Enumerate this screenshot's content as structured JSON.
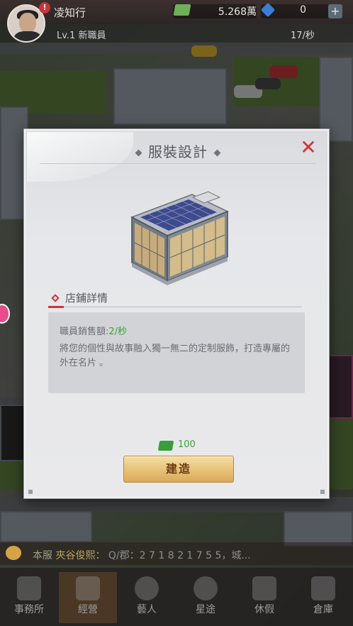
{
  "player": {
    "name": "凌知行",
    "level": "Lv.1 新職員",
    "money": "5.268萬",
    "gems": "0",
    "gem_add": "+",
    "rate": "17/秒",
    "alert": "!"
  },
  "modal": {
    "title": "服裝設計",
    "close": "✕",
    "section_title": "店鋪詳情",
    "sales_label": "職員銷售額:",
    "sales_value": "2/秒",
    "description": "將您的個性與故事融入獨一無二的定制服飾，打造專屬的外在名片 。",
    "cost": "100",
    "build_button": "建造"
  },
  "chat": {
    "server": "本服",
    "who": "夾谷俊熙：",
    "message": "Q/郡：2 7 1 8 2 1 7 5 5，城..."
  },
  "nav": [
    {
      "label": "事務所"
    },
    {
      "label": "經營"
    },
    {
      "label": "藝人"
    },
    {
      "label": "星途"
    },
    {
      "label": "休假"
    },
    {
      "label": "倉庫"
    }
  ],
  "colors": {
    "accent_red": "#d2323a",
    "value_green": "#3aa33a",
    "button_gold": "#e8c47a"
  }
}
